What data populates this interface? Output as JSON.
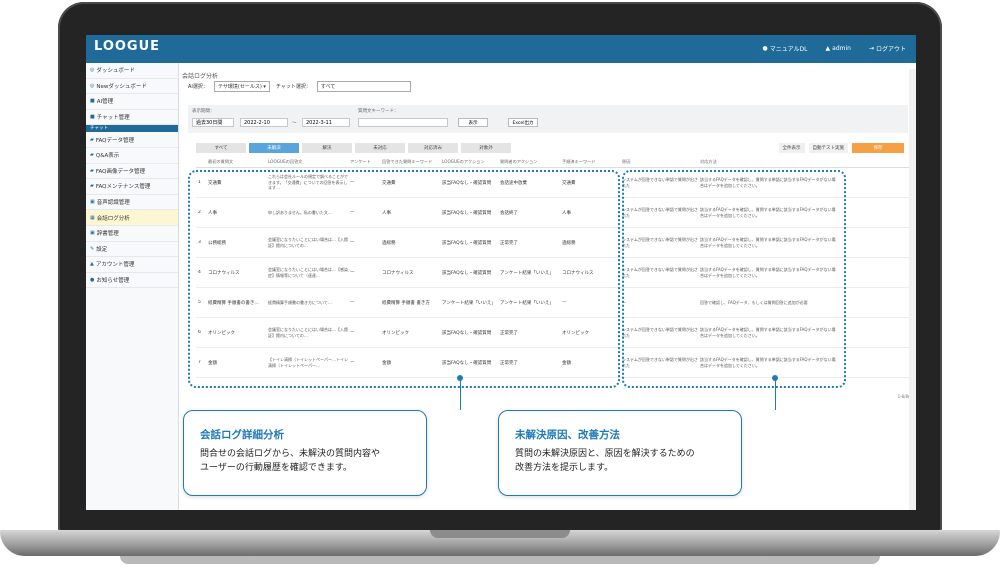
{
  "app": {
    "logo": "LOOGUE",
    "manual": "マニュアルDL",
    "user": "admin",
    "logout": "ログアウト"
  },
  "sidebar": {
    "items": [
      {
        "label": "ダッシュボード"
      },
      {
        "label": "Newダッシュボード"
      },
      {
        "label": "AI管理"
      },
      {
        "label": "チャット管理"
      },
      {
        "label": "FAQデータ管理"
      },
      {
        "label": "Q&A表示"
      },
      {
        "label": "FAQ画像データ管理"
      },
      {
        "label": "FAQメンテナンス管理"
      },
      {
        "label": "音声認識管理"
      },
      {
        "label": "会話ログ分析"
      },
      {
        "label": "辞書管理"
      },
      {
        "label": "設定"
      },
      {
        "label": "アカウント管理"
      },
      {
        "label": "お知らせ管理"
      }
    ],
    "section_label": "チャット"
  },
  "main": {
    "title": "会話ログ分析",
    "filter_ai_label": "AI選択：",
    "filter_ai_value": "テサ環境(セールス)",
    "filter_chat_label": "チャット選択：",
    "filter_chat_value": "すべて",
    "period_label": "表示期間：",
    "period_preset": "過去30日間",
    "date_from": "2022-2-10",
    "date_sep": "〜",
    "date_to": "2022-3-11",
    "keyword_label": "質問文キーワード：",
    "show_button": "表示",
    "excel_button": "Excel出力"
  },
  "tabs": [
    "すべて",
    "未解決",
    "解決",
    "未対応",
    "対応済み",
    "対象外"
  ],
  "tools": [
    "全件表示",
    "自動テスト実施",
    "保存"
  ],
  "table": {
    "headers": [
      "",
      "最初の質問文",
      "LOOGUEの回答文",
      "アンケート",
      "回答できた質問キーワード",
      "LOOGUEのアクション",
      "質問者のアクション",
      "手順済キーワード",
      "原因",
      "対応方法"
    ],
    "rows": [
      [
        "1",
        "交通費",
        "これらは会社ルールの規定で調べることができます。「交通費」についての回答を表示します…",
        "—",
        "交通費",
        "該当FAQなし・確認質問",
        "会話途中放棄",
        "交通費",
        "システムが回答できない単語で質問が出された",
        "該当するFAQデータを確認し、質問する単語に該当するFAQデータがない場合はデータを追加してください。"
      ],
      [
        "2",
        "人事",
        "申し訳ありません。私の書いた文…",
        "—",
        "人事",
        "該当FAQなし・確認質問",
        "会話終了",
        "人事",
        "システムが回答できない単語で質問が出された",
        "該当するFAQデータを確認し、質問する単語に該当するFAQデータがない場合はデータを追加してください。"
      ],
      [
        "3",
        "公務総務",
        "会議室になりたいことにはい場合は…【入館証】館内についての…",
        "—",
        "過総務",
        "該当FAQなし・確認質問",
        "正常完了",
        "過総務",
        "システムが回答できない単語で質問が出された",
        "該当するFAQデータを確認し、質問する単語に該当するFAQデータがない場合はデータを追加してください。"
      ],
      [
        "4",
        "コロナウィルス",
        "会議室になりたいことにはい場合は…【感染症】情報等について（速達…",
        "—",
        "コロナウィルス",
        "該当FAQなし・確認質問",
        "アンケート結果「いいえ」",
        "コロナウィルス",
        "システムが回答できない単語で質問が出された",
        "該当するFAQデータを確認し、質問する単語に該当するFAQデータがない場合はデータを追加してください。"
      ],
      [
        "5",
        "経費精算 手順書の書き…",
        "経費精算手順書の書き方について…",
        "—",
        "経費精算 手順書 書き方",
        "アンケート結果「いいえ」",
        "アンケート結果「いいえ」",
        "—",
        "—",
        "回答で確認し、FAQデータ、もしくは質問回答に追加が必要"
      ],
      [
        "6",
        "オリンピック",
        "会議室になりたいことにはい場合は…【入館証】館内についての…",
        "—",
        "オリンピック",
        "該当FAQなし・確認質問",
        "正常完了",
        "オリンピック",
        "システムが回答できない単語で質問が出された",
        "該当するFAQデータを確認し、質問する単語に該当するFAQデータがない場合はデータを追加してください。"
      ],
      [
        "7",
        "金額",
        "【トイレ清掃（トイレットペーパー…トイレ清掃（トイレットペーパー…",
        "—",
        "金額",
        "該当FAQなし・確認質問",
        "正常完了",
        "金額",
        "システムが回答できない単語で質問が出された",
        "該当するFAQデータを確認し、質問する単語に該当するFAQデータがない場合はデータを追加してください。"
      ]
    ],
    "pager": "1-8/8件"
  },
  "callouts": {
    "left": {
      "title": "会話ログ詳細分析",
      "line1": "問合せの会話ログから、未解決の質問内容や",
      "line2": "ユーザーの行動履歴を確認できます。"
    },
    "right": {
      "title": "未解決原因、改善方法",
      "line1": "質問の未解決原因と、原因を解決するための",
      "line2": "改善方法を提示します。"
    }
  },
  "colors": {
    "appbar": "#1f6a99",
    "accent": "#1f7ab8",
    "tab_active": "#5aa4dc",
    "save": "#f5a044"
  }
}
